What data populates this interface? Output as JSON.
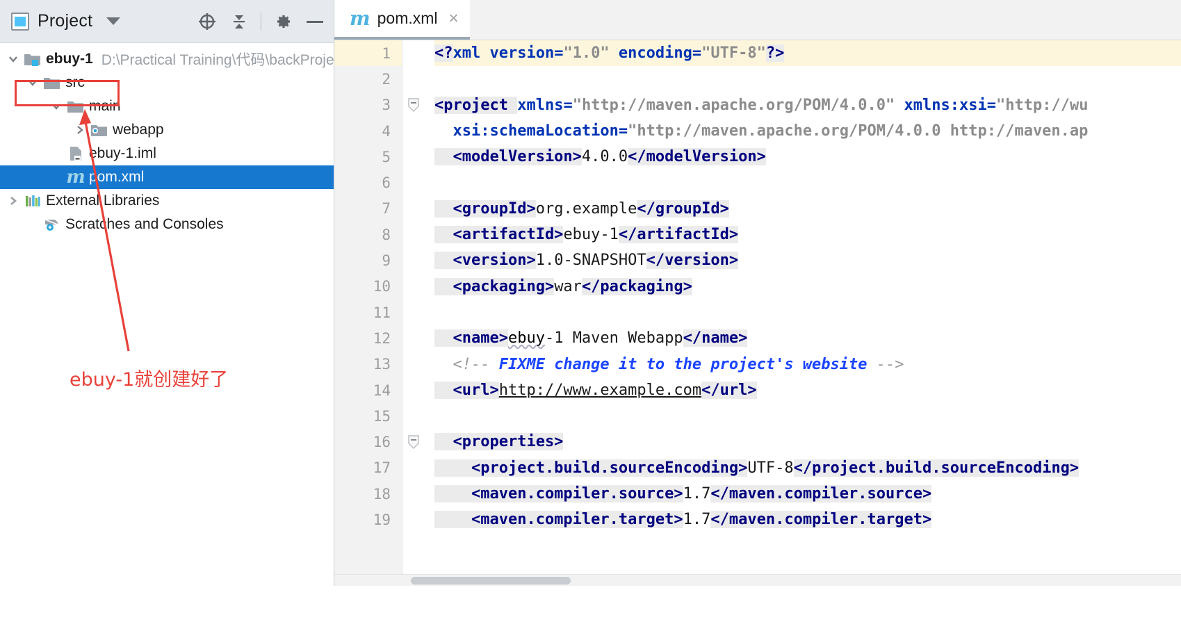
{
  "project_pane": {
    "title": "Project",
    "icons": {
      "window_icon": "project-window-icon",
      "dropdown": "chevron-down-icon",
      "locate": "locate-target-icon",
      "collapse_all": "collapse-all-icon",
      "settings": "gear-icon",
      "hide": "minimize-icon"
    },
    "tree": [
      {
        "label": "ebuy-1",
        "path": "D:\\Practical Training\\代码\\backProje",
        "icon": "module-folder-icon",
        "twisty": "expanded",
        "bold": true,
        "selected": false,
        "indent": 0
      },
      {
        "label": "src",
        "path": "",
        "icon": "folder-icon",
        "twisty": "expanded",
        "bold": false,
        "selected": false,
        "indent": 1
      },
      {
        "label": "main",
        "path": "",
        "icon": "folder-icon",
        "twisty": "expanded",
        "bold": false,
        "selected": false,
        "indent": 2
      },
      {
        "label": "webapp",
        "path": "",
        "icon": "webapp-folder-icon",
        "twisty": "collapsed",
        "bold": false,
        "selected": false,
        "indent": 3
      },
      {
        "label": "ebuy-1.iml",
        "path": "",
        "icon": "iml-file-icon",
        "twisty": "none",
        "bold": false,
        "selected": false,
        "indent": 2
      },
      {
        "label": "pom.xml",
        "path": "",
        "icon": "maven-file-icon",
        "twisty": "none",
        "bold": false,
        "selected": true,
        "indent": 2
      },
      {
        "label": "External Libraries",
        "path": "",
        "icon": "libraries-icon",
        "twisty": "collapsed",
        "bold": false,
        "selected": false,
        "indent": 0
      },
      {
        "label": "Scratches and Consoles",
        "path": "",
        "icon": "scratches-icon",
        "twisty": "none",
        "bold": false,
        "selected": false,
        "indent": 1
      }
    ],
    "annotation": {
      "text": "ebuy-1就创建好了",
      "color": "#e8413a",
      "highlight_target": "ebuy-1"
    }
  },
  "editor": {
    "tab": {
      "name": "pom.xml",
      "icon": "maven-file-icon",
      "close": "×"
    },
    "current_line": 1,
    "line_numbers": [
      "1",
      "2",
      "3",
      "4",
      "5",
      "6",
      "7",
      "8",
      "9",
      "10",
      "11",
      "12",
      "13",
      "14",
      "15",
      "16",
      "17",
      "18",
      "19"
    ],
    "fold_lines": [
      3,
      16
    ],
    "lines": [
      {
        "n": 1,
        "segments": [
          {
            "t": "tag",
            "v": "<?"
          },
          {
            "t": "attr",
            "v": "xml version="
          },
          {
            "t": "aval",
            "v": "\"1.0\""
          },
          {
            "t": "attr",
            "v": " encoding="
          },
          {
            "t": "aval",
            "v": "\"UTF-8\""
          },
          {
            "t": "tag",
            "v": "?>"
          }
        ]
      },
      {
        "n": 2,
        "segments": []
      },
      {
        "n": 3,
        "segments": [
          {
            "t": "tag",
            "v": "<project "
          },
          {
            "t": "attr",
            "v": "xmlns="
          },
          {
            "t": "aval",
            "v": "\"http://maven.apache.org/POM/4.0.0\""
          },
          {
            "t": "attr",
            "v": " xmlns:xsi="
          },
          {
            "t": "aval",
            "v": "\"http://wu"
          }
        ]
      },
      {
        "n": 4,
        "segments": [
          {
            "t": "attr",
            "v": "  xsi:schemaLocation="
          },
          {
            "t": "aval",
            "v": "\"http://maven.apache.org/POM/4.0.0 http://maven.ap"
          }
        ]
      },
      {
        "n": 5,
        "segments": [
          {
            "t": "tag",
            "v": "  <modelVersion>"
          },
          {
            "t": "txt",
            "v": "4.0.0"
          },
          {
            "t": "tag",
            "v": "</modelVersion>"
          }
        ]
      },
      {
        "n": 6,
        "segments": []
      },
      {
        "n": 7,
        "segments": [
          {
            "t": "tag",
            "v": "  <groupId>"
          },
          {
            "t": "txt",
            "v": "org.example"
          },
          {
            "t": "tag",
            "v": "</groupId>"
          }
        ]
      },
      {
        "n": 8,
        "segments": [
          {
            "t": "tag",
            "v": "  <artifactId>"
          },
          {
            "t": "txt",
            "v": "ebuy-1"
          },
          {
            "t": "tag",
            "v": "</artifactId>"
          }
        ]
      },
      {
        "n": 9,
        "segments": [
          {
            "t": "tag",
            "v": "  <version>"
          },
          {
            "t": "txt",
            "v": "1.0-SNAPSHOT"
          },
          {
            "t": "tag",
            "v": "</version>"
          }
        ]
      },
      {
        "n": 10,
        "segments": [
          {
            "t": "tag",
            "v": "  <packaging>"
          },
          {
            "t": "txt",
            "v": "war"
          },
          {
            "t": "tag",
            "v": "</packaging>"
          }
        ]
      },
      {
        "n": 11,
        "segments": []
      },
      {
        "n": 12,
        "segments": [
          {
            "t": "tag",
            "v": "  <name>"
          },
          {
            "t": "squig",
            "v": "ebuy"
          },
          {
            "t": "txt",
            "v": "-1 Maven Webapp"
          },
          {
            "t": "tag",
            "v": "</name>"
          }
        ]
      },
      {
        "n": 13,
        "segments": [
          {
            "t": "cmt-del",
            "v": "  <!-- "
          },
          {
            "t": "cmt-fix",
            "v": "FIXME change it to the project's website"
          },
          {
            "t": "cmt-del",
            "v": " -->"
          }
        ]
      },
      {
        "n": 14,
        "segments": [
          {
            "t": "tag",
            "v": "  <url>"
          },
          {
            "t": "link",
            "v": "http://www.example.com"
          },
          {
            "t": "tag",
            "v": "</url>"
          }
        ]
      },
      {
        "n": 15,
        "segments": []
      },
      {
        "n": 16,
        "segments": [
          {
            "t": "tag",
            "v": "  <properties>"
          }
        ]
      },
      {
        "n": 17,
        "segments": [
          {
            "t": "tag",
            "v": "    <project.build.sourceEncoding>"
          },
          {
            "t": "txt",
            "v": "UTF-8"
          },
          {
            "t": "tag",
            "v": "</project.build.sourceEncoding>"
          }
        ]
      },
      {
        "n": 18,
        "segments": [
          {
            "t": "tag",
            "v": "    <maven.compiler.source>"
          },
          {
            "t": "txt",
            "v": "1.7"
          },
          {
            "t": "tag",
            "v": "</maven.compiler.source>"
          }
        ]
      },
      {
        "n": 19,
        "segments": [
          {
            "t": "tag",
            "v": "    <maven.compiler.target>"
          },
          {
            "t": "txt",
            "v": "1.7"
          },
          {
            "t": "tag",
            "v": "</maven.compiler.target>"
          }
        ]
      }
    ]
  },
  "colors": {
    "selection": "#1778cf",
    "annotation_red": "#e8413a",
    "tag_navy": "#000080",
    "attr_blue": "#0033b3",
    "value_gray": "#8c8c8c",
    "comment_gray": "#9a9a9a",
    "fixme_blue": "#1a44ff",
    "current_line_bg": "#fdf6dd",
    "pane_header_bg": "#e6e9ee"
  }
}
